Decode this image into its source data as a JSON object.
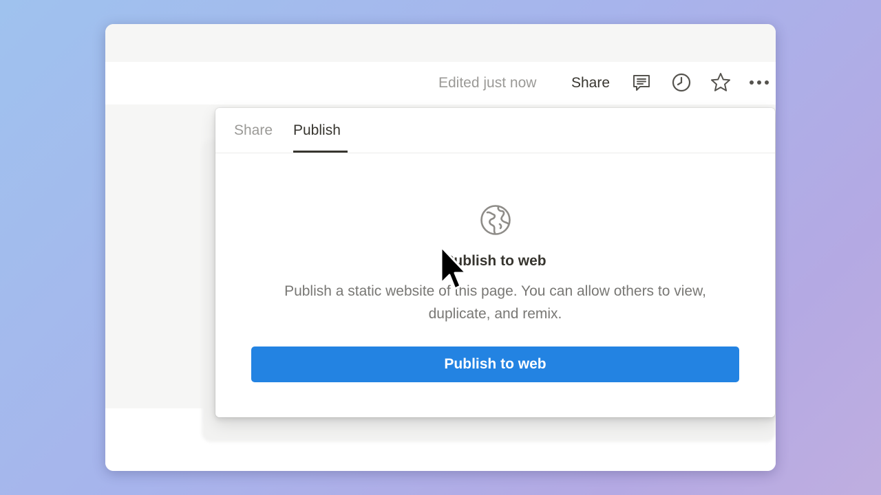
{
  "topbar": {
    "edited_status": "Edited just now",
    "share_label": "Share",
    "icons": [
      "comment-icon",
      "clock-icon",
      "star-icon",
      "more-icon"
    ]
  },
  "popover": {
    "tabs": [
      {
        "label": "Share",
        "active": false
      },
      {
        "label": "Publish",
        "active": true
      }
    ],
    "icon": "globe-icon",
    "title": "Publish to web",
    "description": "Publish a static website of this page. You can allow others to view, duplicate, and remix.",
    "button_label": "Publish to web"
  },
  "colors": {
    "accent": "#2383e2",
    "text": "#37352f",
    "muted": "#9b9a97",
    "background_gradient": [
      "#9fc2ee",
      "#bfaee0"
    ]
  }
}
